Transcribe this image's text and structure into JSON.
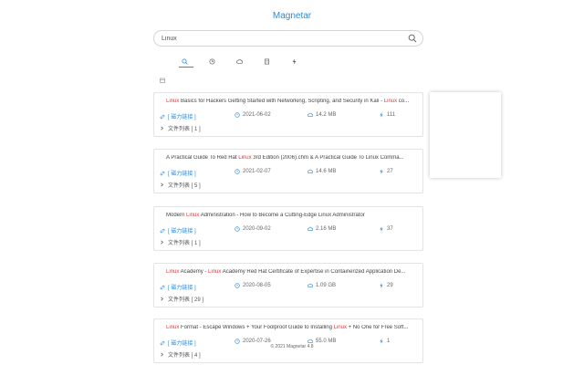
{
  "header": {
    "title": "Magnetar"
  },
  "search": {
    "value": "Linux"
  },
  "tabs": [
    {
      "label": "",
      "icon": "search-icon",
      "active": true
    },
    {
      "label": "",
      "icon": "clock-icon",
      "active": false
    },
    {
      "label": "",
      "icon": "cloud-icon",
      "active": false
    },
    {
      "label": "",
      "icon": "file-icon",
      "active": false
    },
    {
      "label": "",
      "icon": "bolt-icon",
      "active": false
    }
  ],
  "stats": {
    "text": ""
  },
  "tools": {
    "label": ""
  },
  "results": [
    {
      "badge": "",
      "kw": "Linux",
      "title_rest": " Basics for Hackers Getting Started with Networking, Scripting, and Security in Kali - ",
      "kw2": "Linux",
      "title_tail": " co...",
      "magnet": "[ 磁力链接 ]",
      "date": "2021-06-02",
      "size": "14.2 MB",
      "hot": "111",
      "files": "文件列表 [ 1 ]"
    },
    {
      "badge": "",
      "kw": "",
      "title_rest": "A Practical Guide To Red Hat ",
      "kw2": "Linux",
      "title_tail": " 3rd Edition (2006).chm & A Practical Guide To Linux Comma...",
      "magnet": "[ 磁力链接 ]",
      "date": "2021-02-07",
      "size": "14.6 MB",
      "hot": "27",
      "files": "文件列表 [ 5 ]"
    },
    {
      "badge": "",
      "kw": "",
      "title_rest": "Modern ",
      "kw2": "Linux",
      "title_tail": " Administration - How to Become a Cutting-Edge Linux Administrator",
      "magnet": "[ 磁力链接 ]",
      "date": "2020-09-02",
      "size": "2.16 MB",
      "hot": "37",
      "files": "文件列表 [ 1 ]"
    },
    {
      "badge": "",
      "kw": "Linux",
      "title_rest": " Academy - ",
      "kw2": "Linux",
      "title_tail": " Academy Red Hat Certificate of Expertise in Containerized Application De...",
      "magnet": "[ 磁力链接 ]",
      "date": "2020-08-05",
      "size": "1.09 GB",
      "hot": "29",
      "files": "文件列表 [ 29 ]"
    },
    {
      "badge": "",
      "kw": "Linux",
      "title_rest": " Format - Escape Windows + Your Foolproof Guide to Installing ",
      "kw2": "Linux",
      "title_tail": " + No One for Free Soft...",
      "magnet": "[ 磁力链接 ]",
      "date": "2020-07-26",
      "size": "55.0 MB",
      "hot": "1",
      "files": "文件列表 [ 4 ]"
    }
  ],
  "sidebar": {
    "lines": [
      "",
      "",
      "",
      "",
      "",
      "",
      "",
      "",
      "",
      "",
      "",
      ""
    ]
  },
  "footer": {
    "copyright": "© 2021 Magnetar 4.8",
    "contact": ""
  },
  "colors": {
    "accent": "#2e8ad8",
    "keyword": "#e4393c",
    "badge": "#3d8fd9"
  }
}
